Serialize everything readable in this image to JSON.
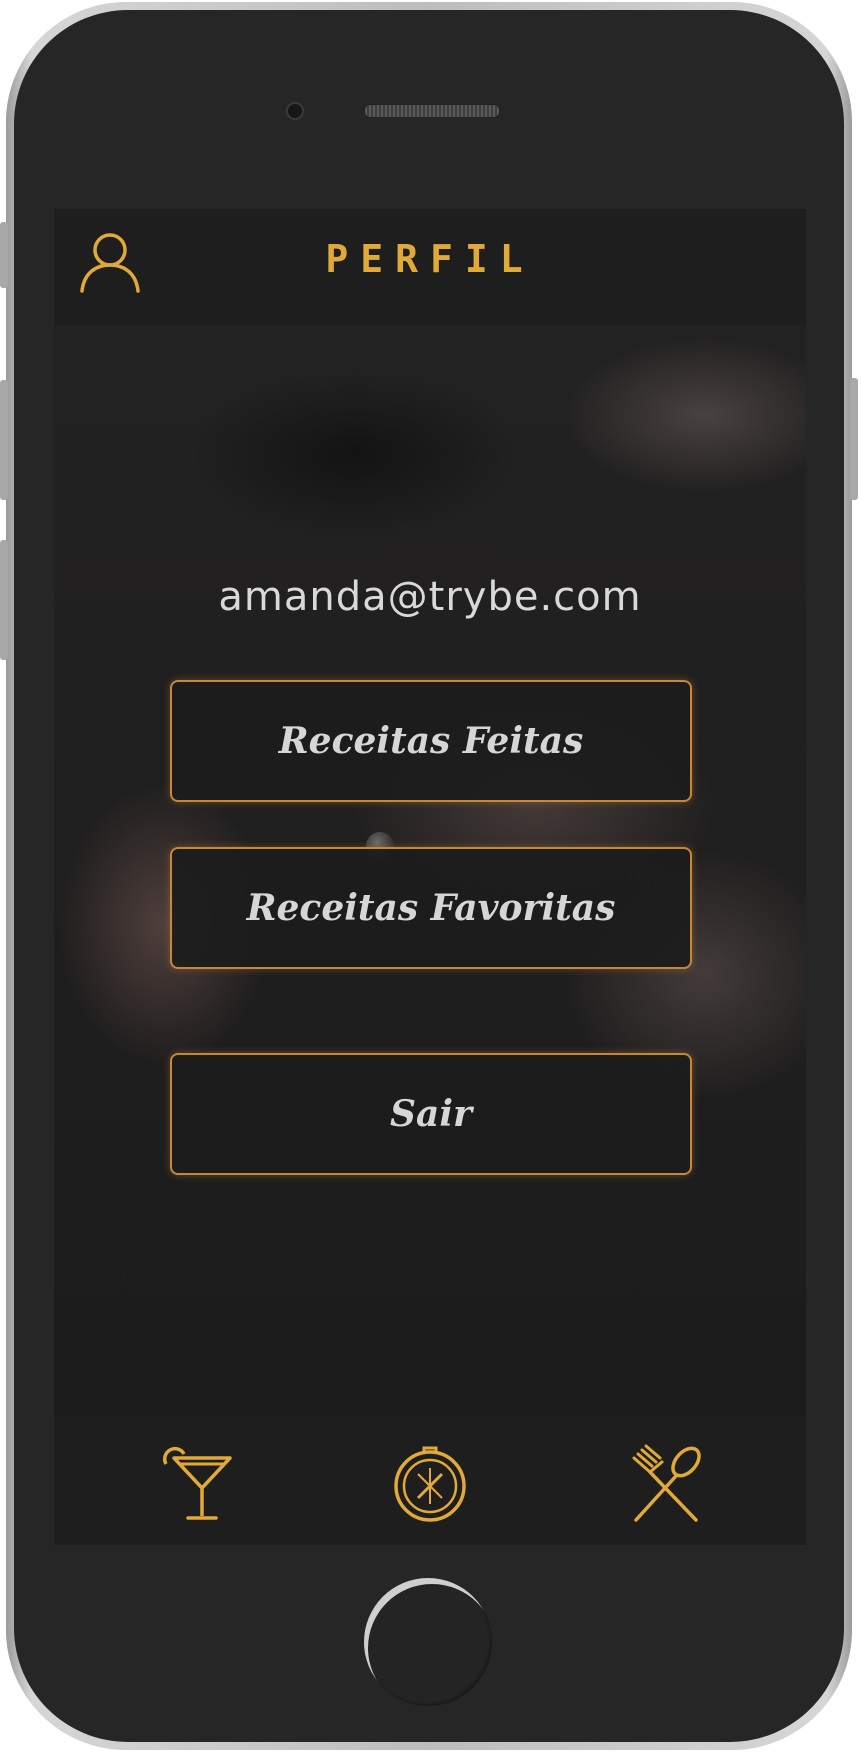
{
  "header": {
    "title": "PERFIL",
    "profile_icon": "user-outline-icon"
  },
  "profile": {
    "email": "amanda@trybe.com"
  },
  "buttons": {
    "done_recipes": "Receitas Feitas",
    "favorite_recipes": "Receitas Favoritas",
    "logout": "Sair"
  },
  "footer": {
    "drinks_icon": "cocktail-glass-icon",
    "explore_icon": "compass-icon",
    "meals_icon": "fork-and-spoon-icon"
  },
  "colors": {
    "accent": "#e0a938",
    "button_border": "#c98733",
    "text_light": "#d9d9d9",
    "background": "#1c1c1c"
  }
}
